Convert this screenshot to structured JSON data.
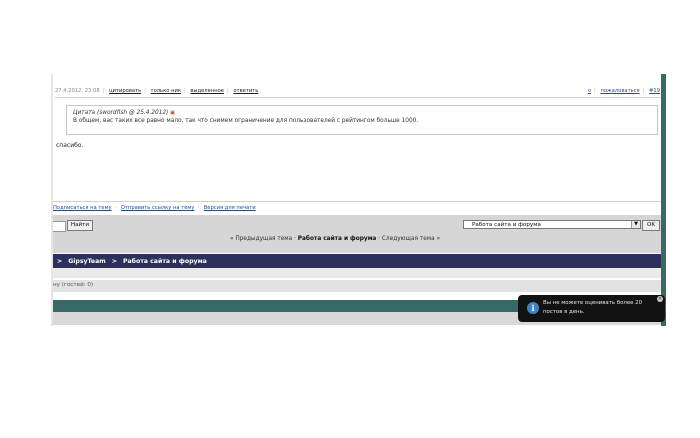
{
  "post": {
    "date": "27.4.2012, 23:08",
    "actions": [
      "цитировать",
      "только ник",
      "выделенное",
      "ответить"
    ],
    "actions_right": [
      "о",
      "пожаловаться",
      "#19"
    ],
    "quote_header": "Цитата (swordfish @ 25.4.2012)",
    "quote_text": "В общем, вас таких все равно мало, так что снимем ограничение для пользователей с рейтингом больше 1000.",
    "body_text": "спасибо."
  },
  "topic_links": [
    "Подписаться на тему",
    "Отправить ссылку на тему",
    "Версия для печати"
  ],
  "search": {
    "find_button": "Найти",
    "forum_select_value": "Работа сайта и форума",
    "ok_button": "OK"
  },
  "topic_nav": {
    "prev": "« Предыдущая тема",
    "current": "Работа сайта и форума",
    "next": "Следующая тема »"
  },
  "breadcrumbs": [
    "GipsyTeam",
    "Работа сайта и форума"
  ],
  "users_line": "ну (гостей: 0)",
  "toast": {
    "message": "Вы не можете оценивать более 20 постов в день.",
    "icon": "info-icon"
  },
  "colors": {
    "navbar": "#2f2f5e",
    "teal": "#376a62",
    "toast_bg": "#121212",
    "info_blue": "#3d82c4"
  }
}
